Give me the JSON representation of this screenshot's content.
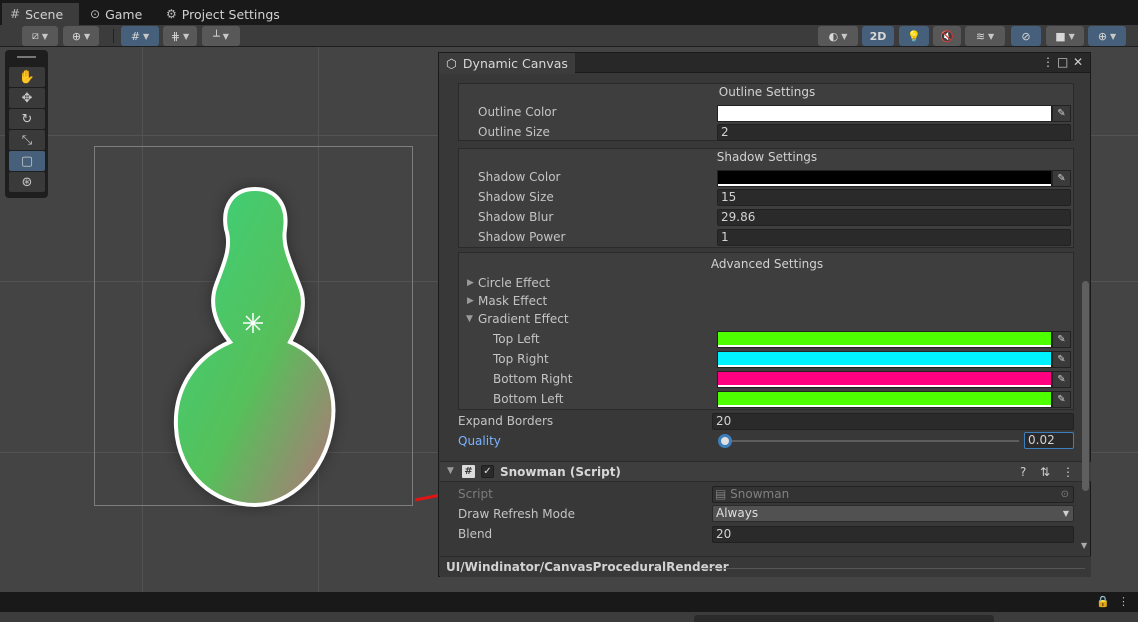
{
  "tabs": [
    {
      "label": "Scene",
      "icon": "scene-grid-icon",
      "active": true
    },
    {
      "label": "Game",
      "icon": "gamepad-icon",
      "active": false
    },
    {
      "label": "Project Settings",
      "icon": "gear-icon",
      "active": false
    }
  ],
  "scene_toolbar": {
    "right_2d_label": "2D"
  },
  "inspector": {
    "title": "Dynamic Canvas",
    "outline": {
      "heading": "Outline Settings",
      "color_label": "Outline Color",
      "color": "#ffffff",
      "size_label": "Outline Size",
      "size_value": "2"
    },
    "shadow": {
      "heading": "Shadow Settings",
      "color_label": "Shadow Color",
      "color": "#000000",
      "size_label": "Shadow Size",
      "size_value": "15",
      "blur_label": "Shadow Blur",
      "blur_value": "29.86",
      "power_label": "Shadow Power",
      "power_value": "1"
    },
    "advanced": {
      "heading": "Advanced Settings",
      "circle_label": "Circle Effect",
      "mask_label": "Mask Effect",
      "gradient_label": "Gradient Effect",
      "top_left_label": "Top Left",
      "top_left_color": "#4dff00",
      "top_right_label": "Top Right",
      "top_right_color": "#00f2ff",
      "bottom_right_label": "Bottom Right",
      "bottom_right_color": "#ff0080",
      "bottom_left_label": "Bottom Left",
      "bottom_left_color": "#4dff00"
    },
    "expand_borders_label": "Expand Borders",
    "expand_borders_value": "20",
    "quality_label": "Quality",
    "quality_value": "0.02",
    "quality_fraction": 0.02,
    "component": {
      "title": "Snowman (Script)",
      "script_label": "Script",
      "script_value": "Snowman",
      "draw_refresh_label": "Draw Refresh Mode",
      "draw_refresh_value": "Always",
      "blend_label": "Blend",
      "blend_value": "20"
    },
    "footer": "UI/Windinator/CanvasProceduralRenderer"
  },
  "colors": {
    "accent": "#46607c",
    "quality_label": "#7ab4ff"
  }
}
